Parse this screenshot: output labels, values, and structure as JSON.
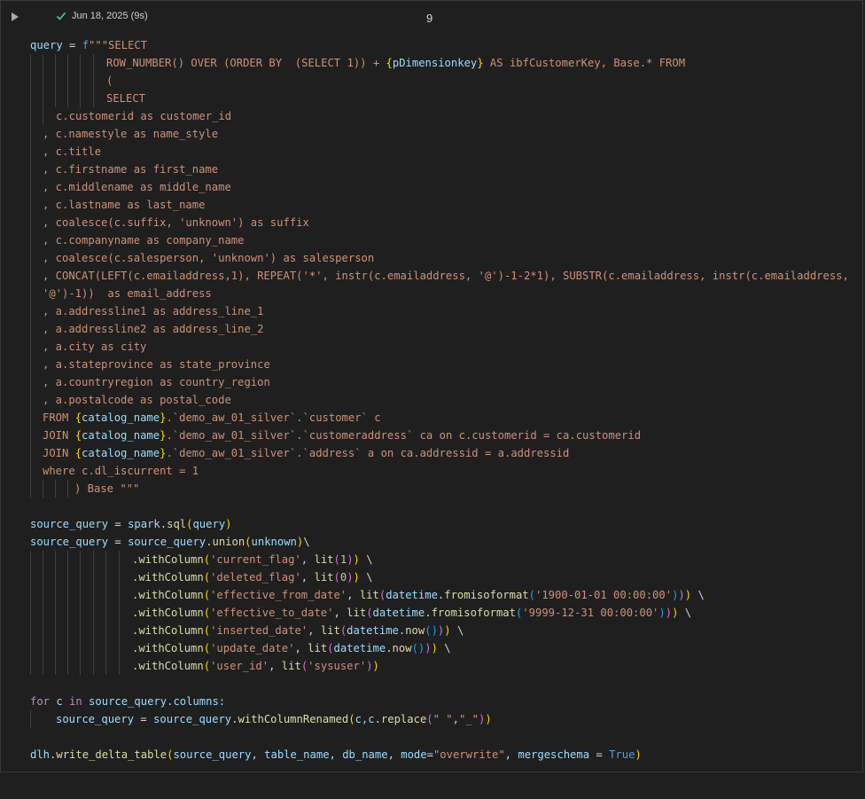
{
  "cell": {
    "status_text": "Jun 18, 2025 (9s)",
    "execution_count": "9",
    "status_color": "#4ec9b0"
  },
  "code": {
    "l1_var": "query",
    "l1_eq": " = ",
    "l1_f": "f",
    "l1_str": "\"\"\"SELECT",
    "l2_a": "ROW_NUMBER() OVER (ORDER BY  (SELECT 1)) + ",
    "l2_brace_open": "{",
    "l2_var": "pDimensionkey",
    "l2_brace_close": "}",
    "l2_b": " AS ibfCustomerKey, Base.* FROM",
    "l3": "(",
    "l4": "SELECT",
    "l5": "c.customerid as customer_id",
    "l6": ", c.namestyle as name_style",
    "l7": ", c.title",
    "l8": ", c.firstname as first_name",
    "l9": ", c.middlename as middle_name",
    "l10": ", c.lastname as last_name",
    "l11": ", coalesce(c.suffix, 'unknown') as suffix",
    "l12": ", c.companyname as company_name",
    "l13": ", coalesce(c.salesperson, 'unknown') as salesperson",
    "l14": ", CONCAT(LEFT(c.emailaddress,1), REPEAT('*', instr(c.emailaddress, '@')-1-2*1), SUBSTR(c.emailaddress, instr(c.emailaddress,",
    "l15": "'@')-1))  as email_address",
    "l16": ", a.addressline1 as address_line_1",
    "l17": ", a.addressline2 as address_line_2",
    "l18": ", a.city as city",
    "l19": ", a.stateprovince as state_province",
    "l20": ", a.countryregion as country_region",
    "l21": ", a.postalcode as postal_code",
    "l22_a": "FROM ",
    "l22_var": "catalog_name",
    "l22_b": ".`demo_aw_01_silver`.`customer` c",
    "l23_a": "JOIN ",
    "l23_var": "catalog_name",
    "l23_b": ".`demo_aw_01_silver`.`customeraddress` ca on c.customerid = ca.customerid",
    "l24_a": "JOIN ",
    "l24_var": "catalog_name",
    "l24_b": ".`demo_aw_01_silver`.`address` a on ca.addressid = a.addressid",
    "l25": "where c.dl_iscurrent = 1",
    "l26": ") Base \"\"\"",
    "l28_var": "source_query",
    "l28_eq": " = ",
    "l28_obj": "spark",
    "l28_fn": ".sql",
    "l28_arg": "query",
    "l29_var": "source_query",
    "l29_eq": " = ",
    "l29_obj": "source_query",
    "l29_fn": ".union",
    "l29_arg": "unknown",
    "l29_tail": "\\",
    "wc_fn": ".withColumn",
    "wc_lit": "lit",
    "wc_dt": "datetime",
    "wc_fromiso": ".fromisoformat",
    "wc_now": ".now",
    "l30_str": "'current_flag'",
    "l30_num": "1",
    "l31_str": "'deleted_flag'",
    "l31_num": "0",
    "l32_str": "'effective_from_date'",
    "l32_val": "'1900-01-01 00:00:00'",
    "l33_str": "'effective_to_date'",
    "l33_val": "'9999-12-31 00:00:00'",
    "l34_str": "'inserted_date'",
    "l35_str": "'update_date'",
    "l36_str": "'user_id'",
    "l36_val": "'sysuser'",
    "l38_for": "for",
    "l38_c": " c ",
    "l38_in": "in",
    "l38_rest": " source_query.columns:",
    "l39_var": "source_query",
    "l39_eq": " = ",
    "l39_obj": "source_query",
    "l39_fn": ".withColumnRenamed",
    "l39_args": "c,c",
    "l39_rep": ".replace",
    "l39_s1": "\" \"",
    "l39_s2": "\"_\"",
    "l41_obj": "dlh",
    "l41_fn": ".write_delta_table",
    "l41_args": "source_query, table_name, db_name, ",
    "l41_mode": "mode",
    "l41_modeval": "\"overwrite\"",
    "l41_ms": "mergeschema",
    "l41_true": "True"
  }
}
